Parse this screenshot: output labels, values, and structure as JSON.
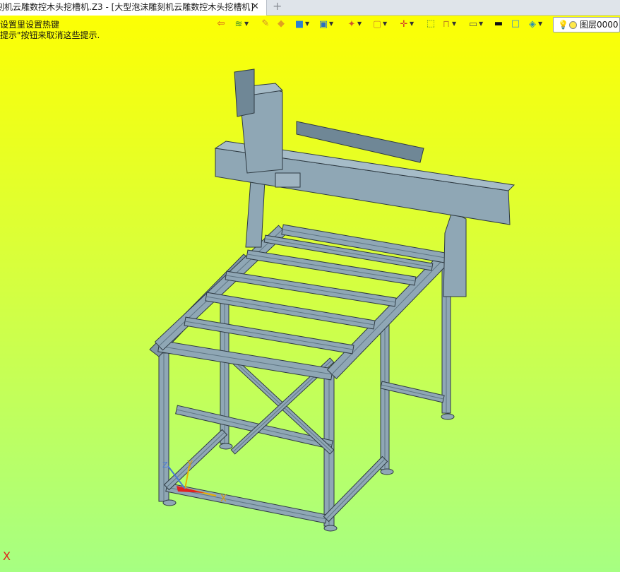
{
  "window": {
    "tab_title": "刻机云雕数控木头挖槽机.Z3 - [大型泡沫雕刻机云雕数控木头挖槽机]",
    "close_glyph": "✕",
    "new_tab_glyph": "+"
  },
  "hints": {
    "line1": "设置里设置热键",
    "line2": "提示\"按钮来取消这些提示."
  },
  "toolbar": {
    "buttons": [
      {
        "name": "exit-icon",
        "glyph": "⇦",
        "color": "#d24a1e",
        "dropdown": false
      },
      {
        "name": "layers-icon",
        "glyph": "≋",
        "color": "#3f8f2a",
        "dropdown": true
      },
      {
        "name": "pen-icon",
        "glyph": "✎",
        "color": "#d28a2a",
        "dropdown": false
      },
      {
        "name": "solid-icon",
        "glyph": "◆",
        "color": "#e0a020",
        "dropdown": false
      },
      {
        "name": "cube-icon",
        "glyph": "■",
        "color": "#2a7fd2",
        "dropdown": true
      },
      {
        "name": "view-cube-icon",
        "glyph": "▣",
        "color": "#2a6fc2",
        "dropdown": true
      },
      {
        "name": "render-icon",
        "glyph": "✦",
        "color": "#d2552a",
        "dropdown": true
      },
      {
        "name": "frame-icon",
        "glyph": "▢",
        "color": "#d28a2a",
        "dropdown": true
      },
      {
        "name": "target-icon",
        "glyph": "✛",
        "color": "#d23a2a",
        "dropdown": true
      },
      {
        "name": "select-box-icon",
        "glyph": "⬚",
        "color": "#3a7a3a",
        "dropdown": false
      },
      {
        "name": "dimension-icon",
        "glyph": "⊓",
        "color": "#c08a20",
        "dropdown": true
      },
      {
        "name": "display-icon",
        "glyph": "▭",
        "color": "#555555",
        "dropdown": true
      },
      {
        "name": "line-style-icon",
        "glyph": "▬",
        "color": "#111111",
        "dropdown": false
      },
      {
        "name": "color-swatch-icon",
        "glyph": "□",
        "color": "#3a8ad2",
        "dropdown": false
      },
      {
        "name": "layer-stack-icon",
        "glyph": "◈",
        "color": "#2a8fb2",
        "dropdown": true
      }
    ]
  },
  "layer": {
    "bulb_glyph": "💡",
    "name": "图层0000"
  },
  "marker": {
    "label": "X"
  },
  "axes": {
    "x_label": "X",
    "y_label": "Y",
    "z_label": "Z"
  },
  "colors": {
    "steel_fill": "#8fa7b5",
    "steel_edge": "#2e3a42",
    "steel_dark": "#5f7684"
  }
}
